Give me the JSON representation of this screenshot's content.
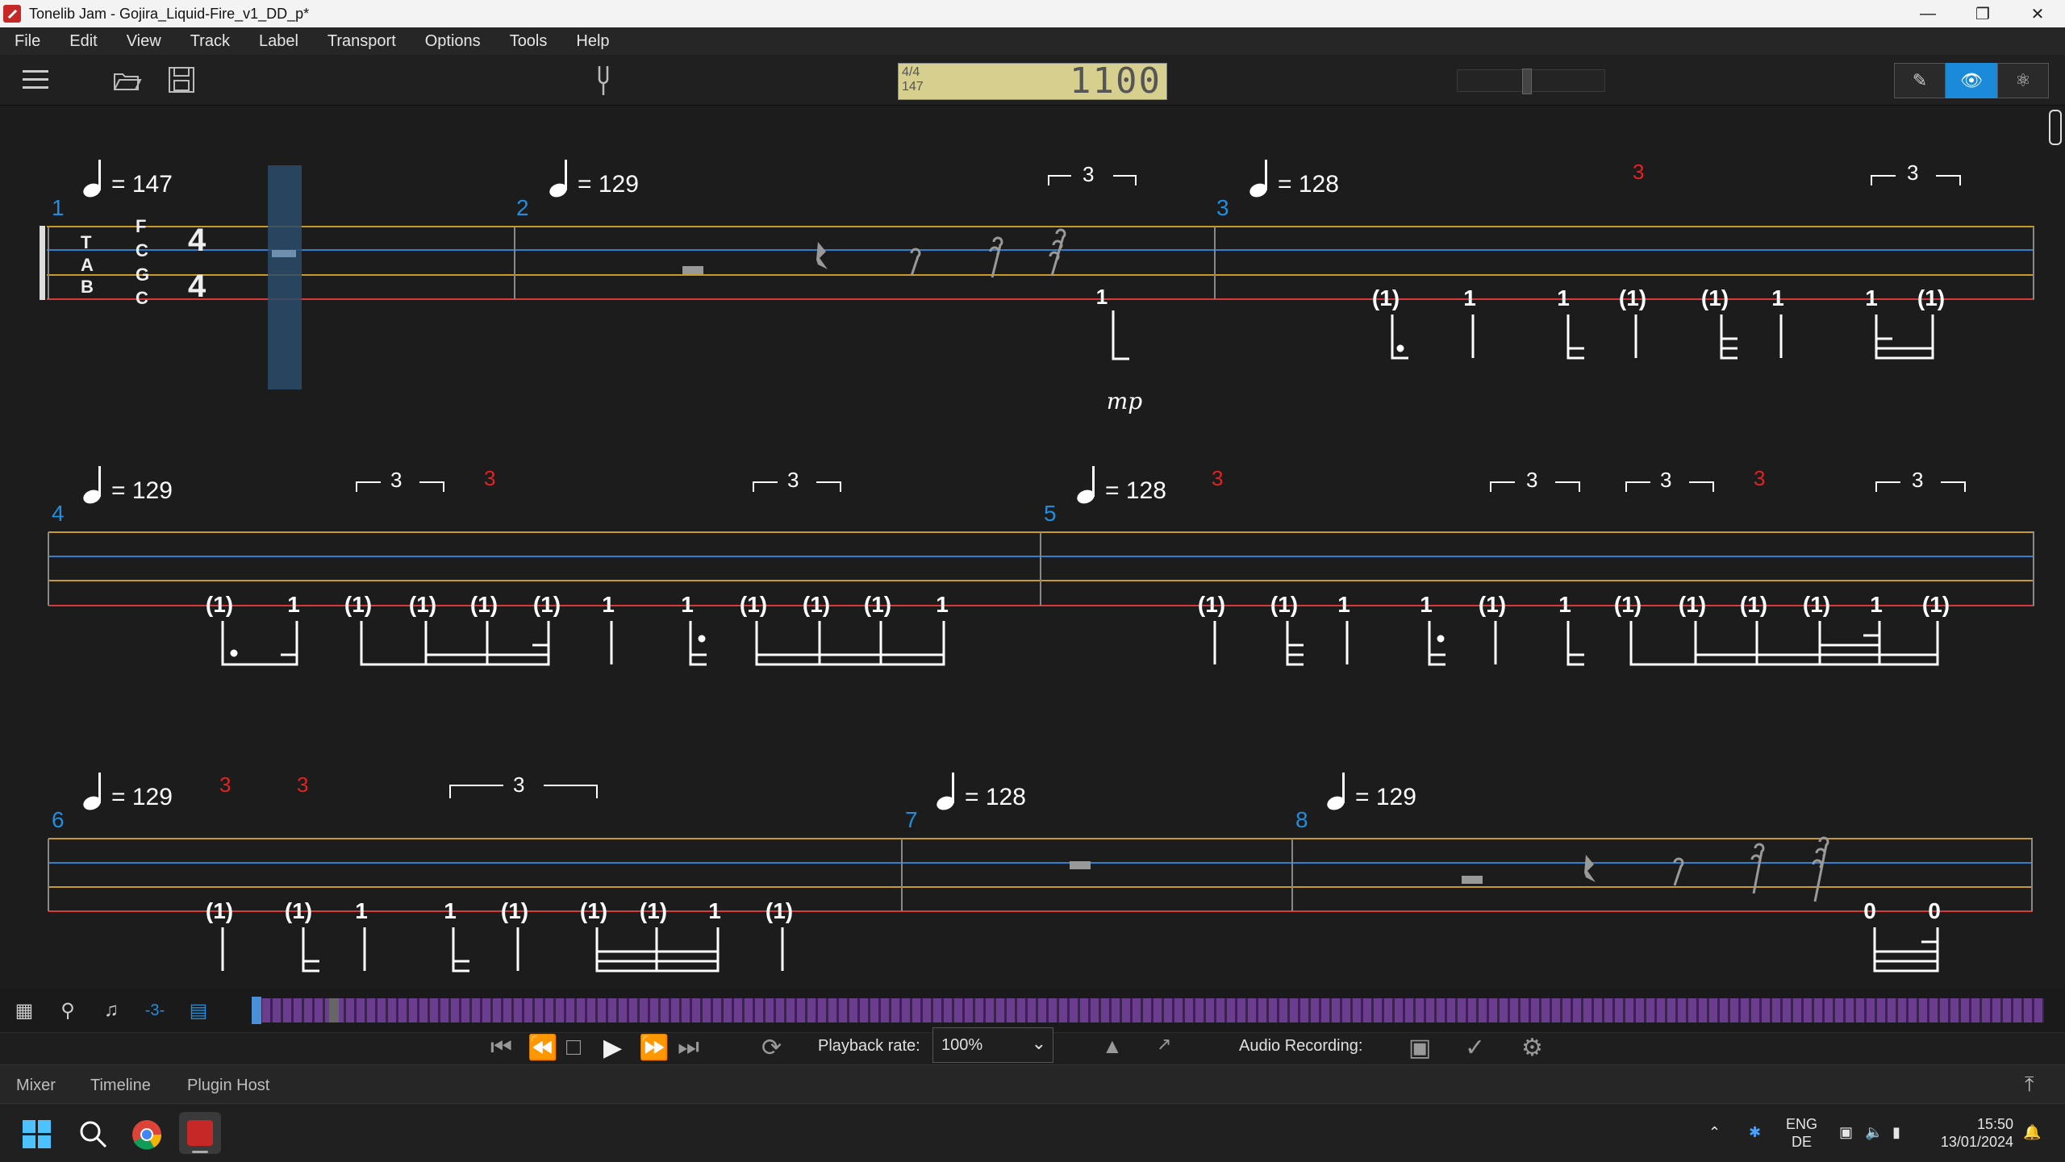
{
  "window": {
    "title": "Tonelib Jam - Gojira_Liquid-Fire_v1_DD_p*"
  },
  "menu": [
    "File",
    "Edit",
    "View",
    "Track",
    "Label",
    "Transport",
    "Options",
    "Tools",
    "Help"
  ],
  "lcd": {
    "time_sig": "4/4",
    "tempo": "147",
    "position": "1100"
  },
  "score": {
    "tab_letters": [
      "T",
      "A",
      "B"
    ],
    "tuning": [
      "F",
      "C",
      "G",
      "C"
    ],
    "time_sig_top": "4",
    "time_sig_bottom": "4",
    "dynamic": "mp",
    "measures": [
      {
        "number": "1",
        "tempo": "147"
      },
      {
        "number": "2",
        "tempo": "129"
      },
      {
        "number": "3",
        "tempo": "128"
      },
      {
        "number": "4",
        "tempo": "129"
      },
      {
        "number": "5",
        "tempo": "128"
      },
      {
        "number": "6",
        "tempo": "129"
      },
      {
        "number": "7",
        "tempo": "128"
      },
      {
        "number": "8",
        "tempo": "129"
      }
    ]
  },
  "transport": {
    "playback_rate_label": "Playback rate:",
    "playback_rate_value": "100%",
    "audio_recording_label": "Audio Recording:"
  },
  "bottom_tabs": [
    "Mixer",
    "Timeline",
    "Plugin Host"
  ],
  "taskbar": {
    "lang_top": "ENG",
    "lang_bottom": "DE",
    "time": "15:50",
    "date": "13/01/2024"
  },
  "colors": {
    "accent": "#1b8ad8",
    "measure_number": "#1f8ee0",
    "tuplet_red": "#e52222"
  }
}
